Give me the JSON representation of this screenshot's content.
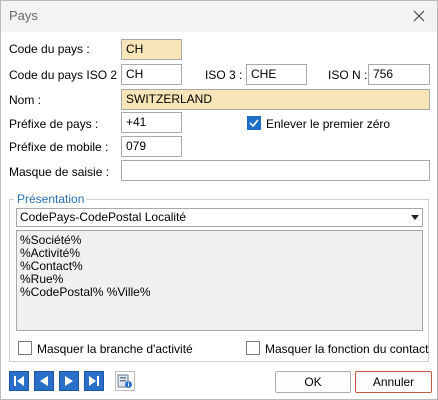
{
  "window": {
    "title": "Pays"
  },
  "fields": {
    "code_label": "Code du pays :",
    "code_value": "CH",
    "iso2_label": "Code du pays ISO 2 :",
    "iso2_value": "CH",
    "iso3_label": "ISO 3 :",
    "iso3_value": "CHE",
    "ison_label": "ISO N :",
    "ison_value": "756",
    "nom_label": "Nom :",
    "nom_value": "SWITZERLAND",
    "prefix_label": "Préfixe de pays :",
    "prefix_value": "+41",
    "remove_zero_label": "Enlever le premier zéro",
    "remove_zero_checked": true,
    "mobile_label": "Préfixe de mobile :",
    "mobile_value": "079",
    "mask_label": "Masque de saisie :",
    "mask_value": ""
  },
  "presentation": {
    "legend": "Présentation",
    "selected": "CodePays-CodePostal Localité",
    "lines": [
      "%Société%",
      "%Activité%",
      "%Contact%",
      "%Rue%",
      "%CodePostal% %Ville%"
    ],
    "hide_branch_label": "Masquer la branche d'activité",
    "hide_branch_checked": false,
    "hide_function_label": "Masquer la fonction du contact",
    "hide_function_checked": false
  },
  "footer": {
    "nav_icons": [
      "first-record-icon",
      "previous-record-icon",
      "next-record-icon",
      "last-record-icon",
      "record-info-icon"
    ],
    "ok_label": "OK",
    "cancel_label": "Annuler"
  },
  "colors": {
    "required_field": "#f7e5b8",
    "accent": "#2a6fc7",
    "legend": "#2a6fb5",
    "cancel_border": "#c8573d"
  }
}
